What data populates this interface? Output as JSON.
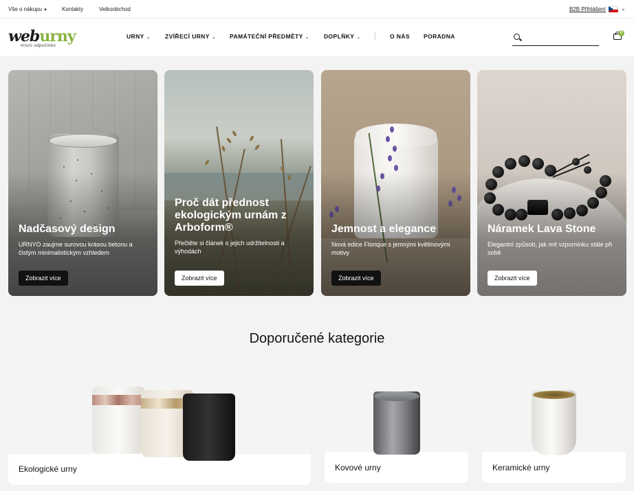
{
  "topbar": {
    "about_shopping": "Vše o nákupu",
    "contacts": "Kontakty",
    "wholesale": "Velkoobchod",
    "b2b_login": "B2B Přihlášení"
  },
  "logo": {
    "part1": "web",
    "part2": "urny",
    "tagline": "místo odpočinku"
  },
  "nav": {
    "urns": "URNY",
    "animal_urns": "ZVÍŘECÍ URNY",
    "memorial": "PAMÁTEČNÍ PŘEDMĚTY",
    "accessories": "DOPLŇKY",
    "about": "O NÁS",
    "advice": "PORADNA"
  },
  "search": {
    "placeholder": ""
  },
  "cart": {
    "count": "0"
  },
  "hero": [
    {
      "title": "Nadčasový design",
      "desc": "URNYO zaujme surovou krásou betonu a čistým minimalistickým vzhledem",
      "button": "Zobrazit více"
    },
    {
      "title": "Proč dát přednost ekologickým urnám z Arboform®",
      "desc": "Přečtěte si článek o jejich udržitelnosti a výhodách",
      "button": "Zobrazit více"
    },
    {
      "title": "Jemnost a elegance",
      "desc": "Nová edice Florique s jemnými květinovými motivy",
      "button": "Zobrazit více"
    },
    {
      "title": "Náramek Lava Stone",
      "desc": "Elegantní způsob, jak mít vzpomínku stále při sobě",
      "button": "Zobrazit více"
    }
  ],
  "section": {
    "title": "Doporučené kategorie"
  },
  "categories": [
    {
      "label": "Ekologické urny"
    },
    {
      "label": "Kovové urny"
    },
    {
      "label": "Keramické urny"
    }
  ],
  "colors": {
    "brand_green": "#8ab33f",
    "dark": "#111111"
  }
}
